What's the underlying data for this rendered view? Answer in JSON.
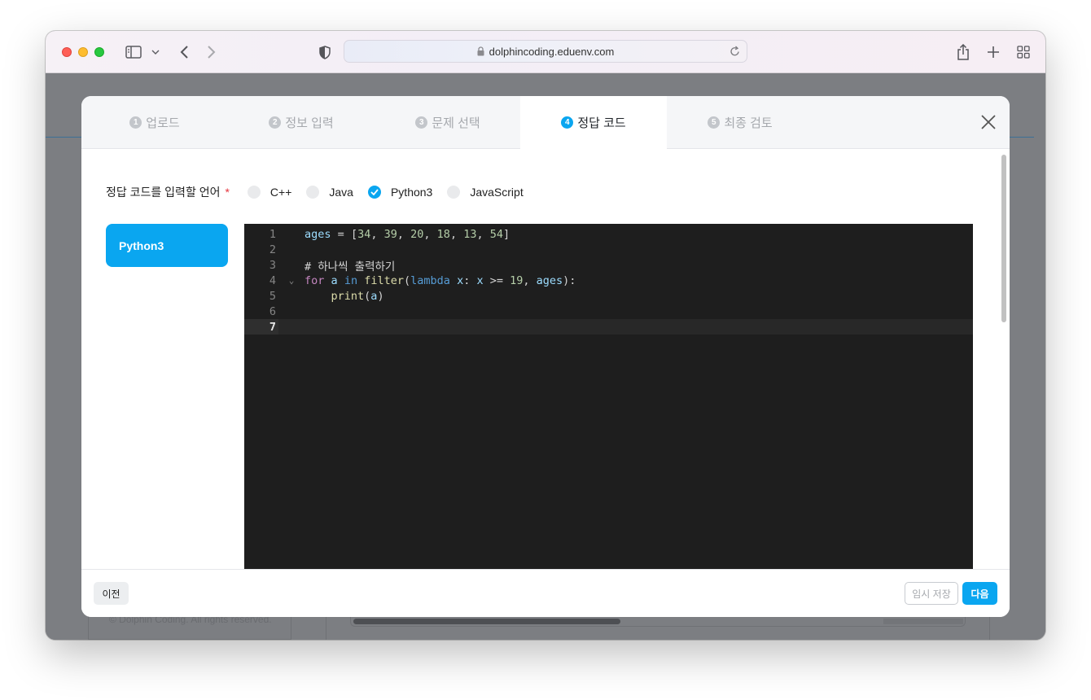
{
  "browser": {
    "url": "dolphincoding.eduenv.com"
  },
  "page_behind": {
    "footer_text": "© Dolphin Coding. All rights reserved."
  },
  "modal": {
    "tabs": [
      {
        "num": "1",
        "label": "업로드",
        "active": false
      },
      {
        "num": "2",
        "label": "정보 입력",
        "active": false
      },
      {
        "num": "3",
        "label": "문제 선택",
        "active": false
      },
      {
        "num": "4",
        "label": "정답 코드",
        "active": true
      },
      {
        "num": "5",
        "label": "최종 검토",
        "active": false
      }
    ],
    "lang_label": "정답 코드를 입력할 언어",
    "required_mark": "*",
    "languages": [
      {
        "label": "C++",
        "checked": false
      },
      {
        "label": "Java",
        "checked": false
      },
      {
        "label": "Python3",
        "checked": true
      },
      {
        "label": "JavaScript",
        "checked": false
      }
    ],
    "selected_lang_tab": "Python3",
    "editor": {
      "current_line": 7,
      "lines": [
        {
          "n": "1",
          "text": "ages = [34, 39, 20, 18, 13, 54]"
        },
        {
          "n": "2",
          "text": ""
        },
        {
          "n": "3",
          "text": "# 하나씩 출력하기"
        },
        {
          "n": "4",
          "text": "for a in filter(lambda x: x >= 19, ages):"
        },
        {
          "n": "5",
          "text": "    print(a)"
        },
        {
          "n": "6",
          "text": ""
        },
        {
          "n": "7",
          "text": ""
        }
      ]
    },
    "footer": {
      "prev_label": "이전",
      "save_label": "임시 저장",
      "next_label": "다음"
    }
  },
  "colors": {
    "accent": "#0aa6f0",
    "editor_bg": "#1e1e1e",
    "required": "#e5343d"
  }
}
